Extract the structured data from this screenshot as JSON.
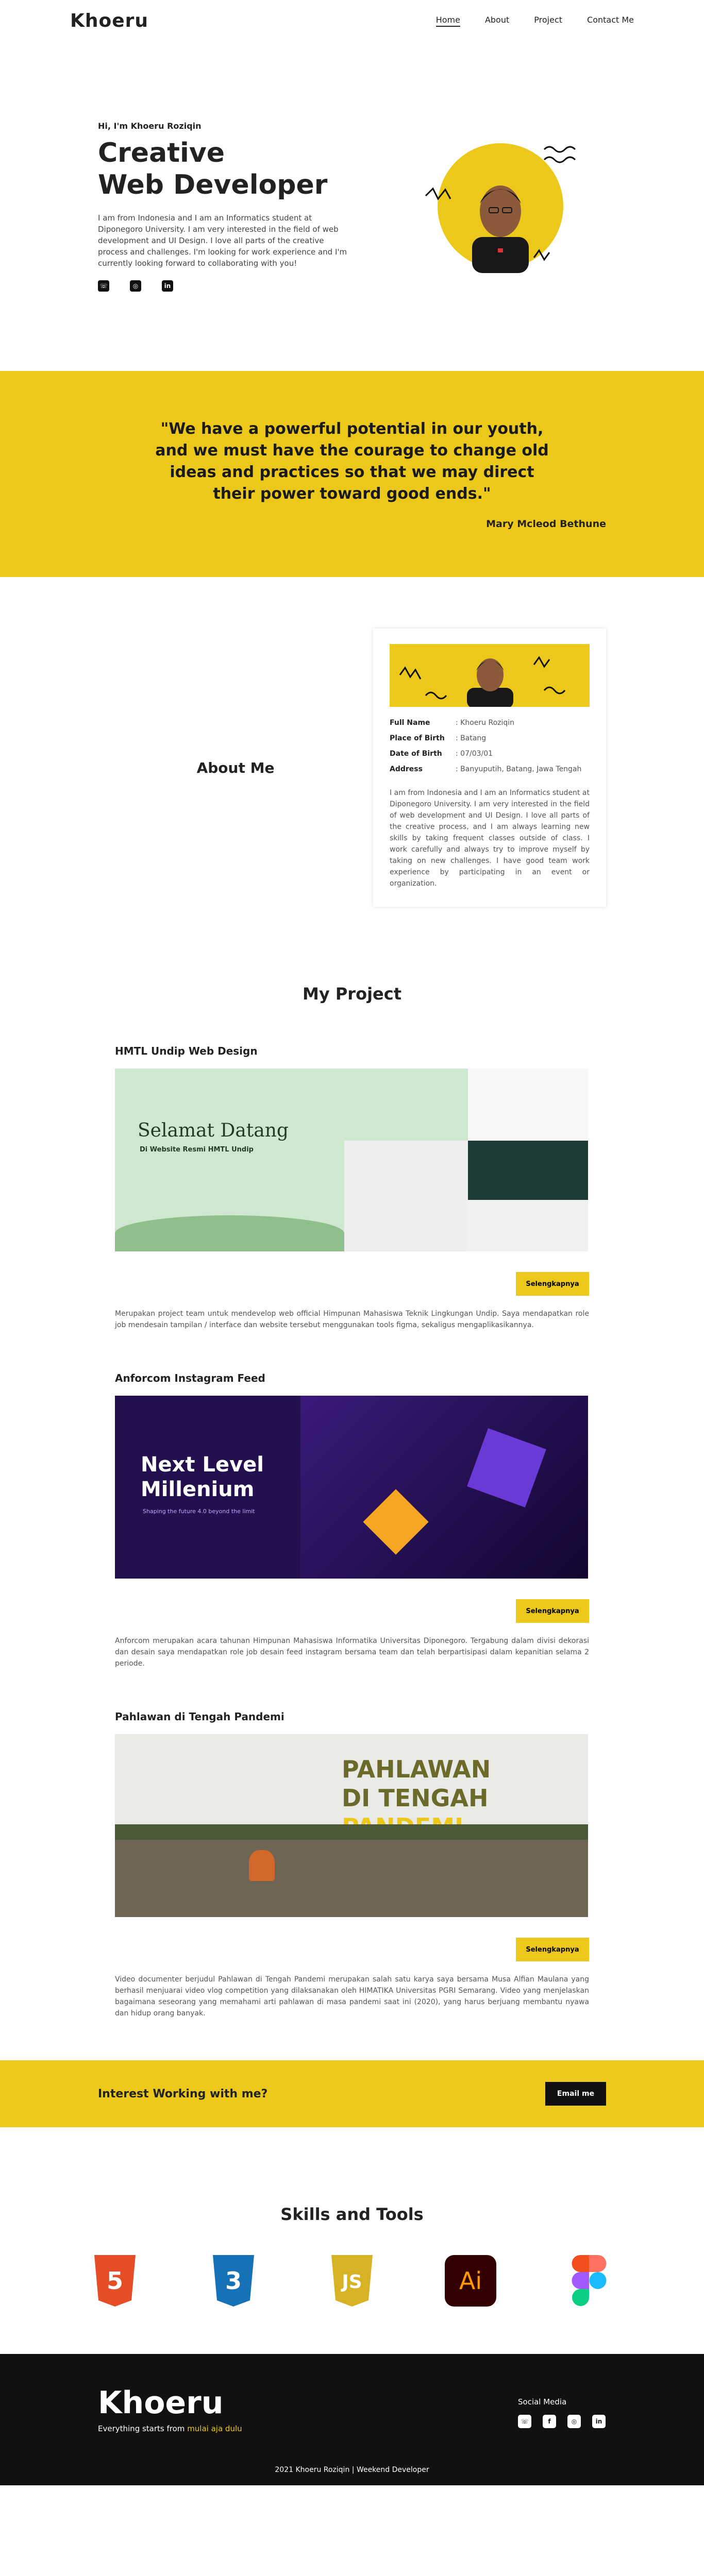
{
  "nav": {
    "logo": "Khoeru",
    "links": [
      "Home",
      "About",
      "Project",
      "Contact Me"
    ]
  },
  "hero": {
    "greeting": "Hi, I'm Khoeru Roziqin",
    "title_line1": "Creative",
    "title_line2": "Web Developer",
    "description": "I am from Indonesia and I am an Informatics student at Diponegoro University. I am very interested in the field of web development and UI Design. I love all parts of the creative process and challenges. I'm looking for work experience and I'm currently looking forward to collaborating with you!",
    "socials": [
      "whatsapp-icon",
      "instagram-icon",
      "linkedin-icon"
    ]
  },
  "quote": {
    "text": "\"We have a powerful potential in our youth, and we must have the courage to change old ideas and practices so that we may direct their power toward good ends.\"",
    "author": "Mary Mcleod Bethune"
  },
  "about": {
    "title": "About Me",
    "rows": [
      {
        "key": "Full Name",
        "value": ": Khoeru Roziqin"
      },
      {
        "key": "Place of Birth",
        "value": ": Batang"
      },
      {
        "key": "Date of Birth",
        "value": ": 07/03/01"
      },
      {
        "key": "Address",
        "value": ": Banyuputih, Batang, Jawa Tengah"
      }
    ],
    "description": "I am from Indonesia and I am an Informatics student at Diponegoro University. I am very interested in the field of web development and UI Design. I love all parts of the creative process, and I am always learning new skills by taking frequent classes outside of class. I work carefully and always try to improve myself by taking on new challenges. I have good team work experience by participating in an event or organization."
  },
  "projects": {
    "title": "My Project",
    "button_label": "Selengkapnya",
    "items": [
      {
        "name": "HMTL Undip Web Design",
        "img_title": "Selamat Datang",
        "img_sub": "Di Website Resmi HMTL Undip",
        "description": "Merupakan project team untuk mendevelop web official Himpunan Mahasiswa Teknik Lingkungan Undip. Saya mendapatkan role job mendesain tampilan / interface dan website tersebut menggunakan tools figma, sekaligus mengaplikasikannya."
      },
      {
        "name": "Anforcom Instagram Feed",
        "img_title": "Next Level Millenium",
        "img_sub": "Shaping the future 4.0 beyond the limit",
        "description": "Anforcom merupakan acara tahunan Himpunan Mahasiswa Informatika Universitas Diponegoro. Tergabung dalam divisi dekorasi dan desain saya mendapatkan role job desain feed instagram bersama team dan telah berpartisipasi dalam kepanitian selama 2 periode."
      },
      {
        "name": "Pahlawan di Tengah Pandemi",
        "img_title1": "PAHLAWAN",
        "img_title2": "DI TENGAH",
        "img_title3": "PANDEMI",
        "description": "Video documenter berjudul Pahlawan di Tengah Pandemi merupakan salah satu karya saya bersama Musa Alfian Maulana yang berhasil menjuarai video vlog competition yang dilaksanakan oleh HIMATIKA Universitas PGRI Semarang. Video yang menjelaskan bagaimana seseorang yang memahami arti pahlawan di masa pandemi saat ini (2020), yang harus berjuang membantu nyawa dan hidup orang banyak."
      }
    ]
  },
  "cta": {
    "text": "Interest Working with me?",
    "button": "Email me"
  },
  "skills": {
    "title": "Skills and Tools",
    "items": [
      {
        "name": "html5-icon",
        "label": "5",
        "color": "#e44d26"
      },
      {
        "name": "css3-icon",
        "label": "3",
        "color": "#1572b6"
      },
      {
        "name": "javascript-icon",
        "label": "JS",
        "color": "#d6b224"
      },
      {
        "name": "illustrator-icon",
        "label": "Ai",
        "color": "#330000"
      },
      {
        "name": "figma-icon",
        "label": "",
        "color": "#a259ff"
      }
    ]
  },
  "footer": {
    "logo": "Khoeru",
    "tag_pre": "Everything starts from ",
    "tag_hl": "mulai aja dulu",
    "social_title": "Social Media",
    "copyright": "2021 Khoeru Roziqin | Weekend Developer"
  }
}
